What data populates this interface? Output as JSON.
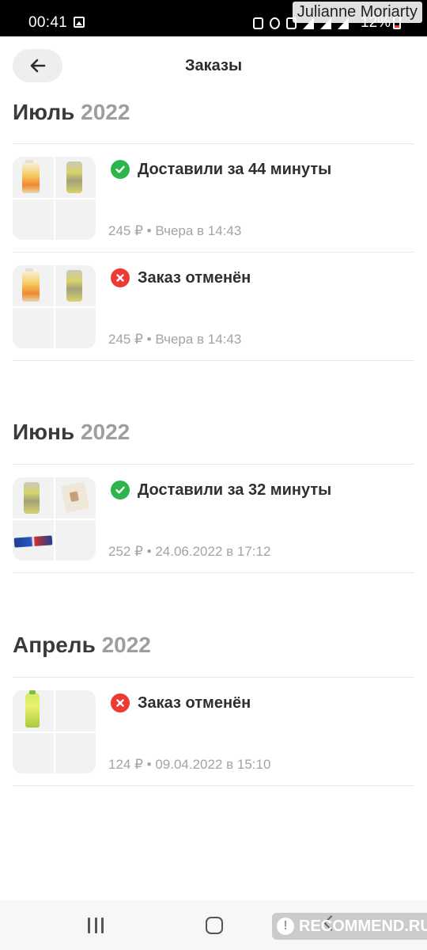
{
  "status_bar": {
    "time": "00:41",
    "battery": "12%",
    "battery_color": "#e53935"
  },
  "watermark": {
    "name": "Julianne Moriarty",
    "logo": "RECOMMEND.RU"
  },
  "header": {
    "title": "Заказы",
    "back_icon": "arrow-left-icon"
  },
  "colors": {
    "success": "#2db54b",
    "error": "#ec3b35",
    "muted": "#a3a3a3"
  },
  "sections": [
    {
      "month": "Июль",
      "year": "2022",
      "orders": [
        {
          "status": "Доставили за 44 минуты",
          "status_type": "success",
          "price": "245 ₽",
          "separator": "•",
          "date": "Вчера в 14:43"
        },
        {
          "status": "Заказ отменён",
          "status_type": "cancelled",
          "price": "245 ₽",
          "separator": "•",
          "date": "Вчера в 14:43"
        }
      ]
    },
    {
      "month": "Июнь",
      "year": "2022",
      "orders": [
        {
          "status": "Доставили за 32 минуты",
          "status_type": "success",
          "price": "252 ₽",
          "separator": "•",
          "date": "24.06.2022 в 17:12"
        }
      ]
    },
    {
      "month": "Апрель",
      "year": "2022",
      "orders": [
        {
          "status": "Заказ отменён",
          "status_type": "cancelled",
          "price": "124 ₽",
          "separator": "•",
          "date": "09.04.2022 в 15:10"
        }
      ]
    }
  ]
}
